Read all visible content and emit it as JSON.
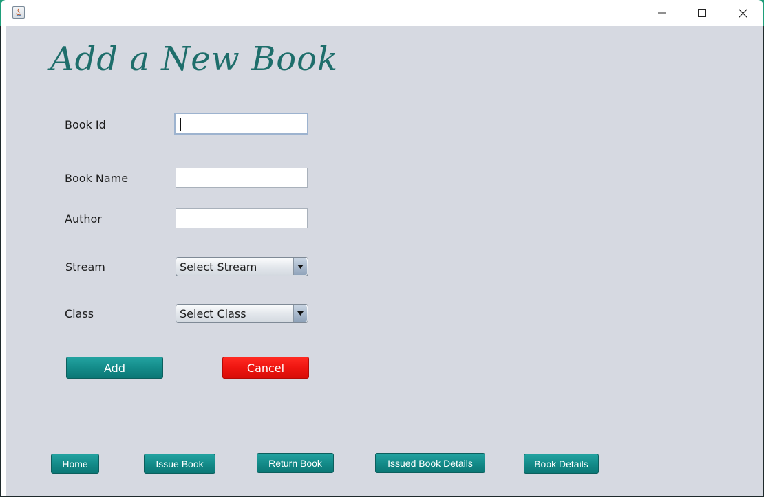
{
  "window": {
    "controls": {
      "minimize_icon": "minimize-icon",
      "maximize_icon": "maximize-icon",
      "close_icon": "close-icon"
    }
  },
  "form": {
    "title": "Add a New Book",
    "fields": {
      "book_id": {
        "label": "Book Id",
        "value": ""
      },
      "book_name": {
        "label": "Book Name",
        "value": ""
      },
      "author": {
        "label": "Author",
        "value": ""
      },
      "stream": {
        "label": "Stream",
        "selected": "Select Stream"
      },
      "class": {
        "label": "Class",
        "selected": "Select Class"
      }
    },
    "buttons": {
      "add": "Add",
      "cancel": "Cancel"
    }
  },
  "nav": {
    "home": "Home",
    "issue_book": "Issue Book",
    "return_book": "Return Book",
    "issued_book_details": "Issued Book Details",
    "book_details": "Book Details"
  },
  "colors": {
    "accent_teal": "#148c8a",
    "cancel_red": "#ee1510",
    "heading": "#1e6e6b",
    "background": "#d6d9e1"
  }
}
